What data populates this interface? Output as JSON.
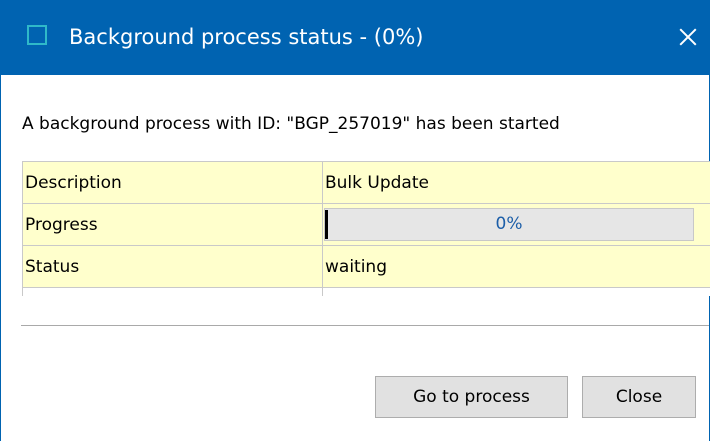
{
  "window": {
    "title": "Background process status - (0%)",
    "icon": "app-icon",
    "close_icon": "close-icon"
  },
  "message": "A background process with ID: \"BGP_257019\" has been started",
  "details": {
    "rows": [
      {
        "label": "Description",
        "value": "Bulk Update"
      },
      {
        "label": "Progress",
        "value": "0%",
        "progress_fraction": 0
      },
      {
        "label": "Status",
        "value": "waiting"
      }
    ]
  },
  "buttons": {
    "go_to_process": "Go to process",
    "close": "Close"
  },
  "colors": {
    "titlebar": "#0063b1",
    "row_background": "#ffffcc",
    "progress_text": "#1c5ea8"
  }
}
